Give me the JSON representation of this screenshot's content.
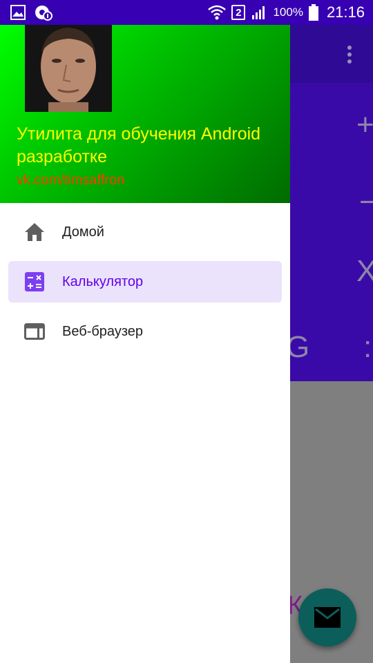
{
  "status_bar": {
    "battery_percent": "100%",
    "time": "21:16",
    "sim_slot": "2",
    "left_icons": [
      "gallery-icon",
      "settings-notification-icon"
    ],
    "right_icons": [
      "wifi-icon",
      "sim-icon",
      "signal-icon",
      "battery-icon"
    ],
    "bg_color": "#3700b3"
  },
  "drawer": {
    "header": {
      "title": "Утилита для обучения Android разработке",
      "subtitle": "vk.com/timsaffron"
    },
    "menu": [
      {
        "label": "Домой",
        "icon": "home-icon",
        "active": false
      },
      {
        "label": "Калькулятор",
        "icon": "calculator-icon",
        "active": true
      },
      {
        "label": "Веб-браузер",
        "icon": "web-browser-icon",
        "active": false
      }
    ],
    "accent_color": "#6200ee"
  },
  "background_app": {
    "operators": [
      "+",
      "−",
      "X",
      ":"
    ],
    "partial_letter": "G",
    "bottom_button_fragment": "К Н",
    "fab_icon": "mail-icon"
  }
}
